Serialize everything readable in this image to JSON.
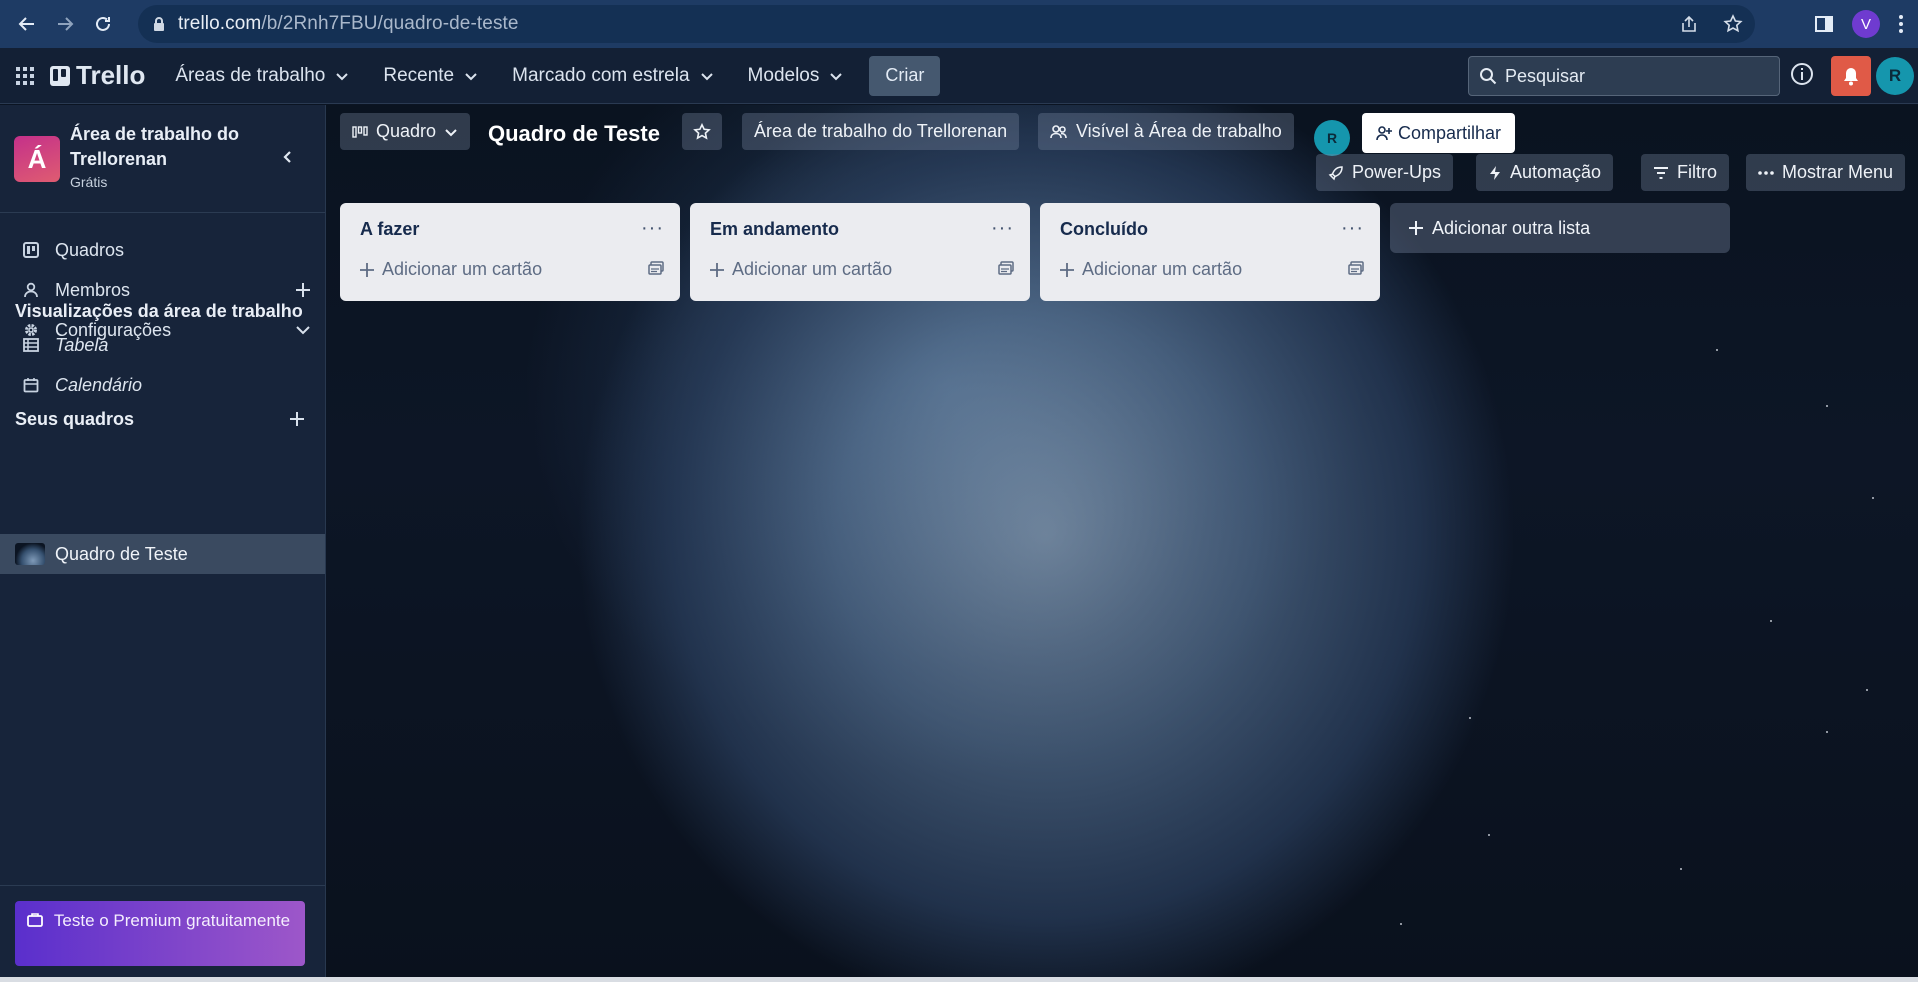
{
  "browser": {
    "url_host": "trello.com",
    "url_path": "/b/2Rnh7FBU/quadro-de-teste",
    "profile_initial": "V"
  },
  "header": {
    "logo_text": "Trello",
    "menu": [
      {
        "label": "Áreas de trabalho"
      },
      {
        "label": "Recente"
      },
      {
        "label": "Marcado com estrela"
      },
      {
        "label": "Modelos"
      }
    ],
    "create_label": "Criar",
    "search_placeholder": "Pesquisar",
    "avatar_initial": "R"
  },
  "sidebar": {
    "workspace_initial": "Á",
    "workspace_name": "Área de trabalho do Trellorenan",
    "workspace_plan": "Grátis",
    "items": [
      {
        "label": "Quadros",
        "icon": "board-icon"
      },
      {
        "label": "Membros",
        "icon": "person-icon"
      },
      {
        "label": "Configurações",
        "icon": "gear-icon"
      }
    ],
    "views_title": "Visualizações da área de trabalho",
    "views": [
      {
        "label": "Tabela",
        "icon": "table-icon"
      },
      {
        "label": "Calendário",
        "icon": "calendar-icon"
      }
    ],
    "boards_title": "Seus quadros",
    "boards": [
      {
        "label": "Quadro de Teste"
      }
    ],
    "premium_label": "Teste o Premium gratuitamente"
  },
  "board": {
    "view_label": "Quadro",
    "title": "Quadro de Teste",
    "workspace_label": "Área de trabalho do Trellorenan",
    "visibility_label": "Visível à Área de trabalho",
    "member_initial": "R",
    "share_label": "Compartilhar",
    "powerups_label": "Power-Ups",
    "automation_label": "Automação",
    "filter_label": "Filtro",
    "menu_label": "Mostrar Menu",
    "lists": [
      {
        "title": "A fazer",
        "add_card_label": "Adicionar um cartão"
      },
      {
        "title": "Em andamento",
        "add_card_label": "Adicionar um cartão"
      },
      {
        "title": "Concluído",
        "add_card_label": "Adicionar um cartão"
      }
    ],
    "add_list_label": "Adicionar outra lista"
  },
  "colors": {
    "browser_bar": "#1e3b64",
    "trello_header": "#132035",
    "sidebar": "#17243a",
    "alert": "#e05a47",
    "avatar": "#1596ad",
    "premium_start": "#5a2fcc",
    "premium_end": "#9d57c9"
  }
}
